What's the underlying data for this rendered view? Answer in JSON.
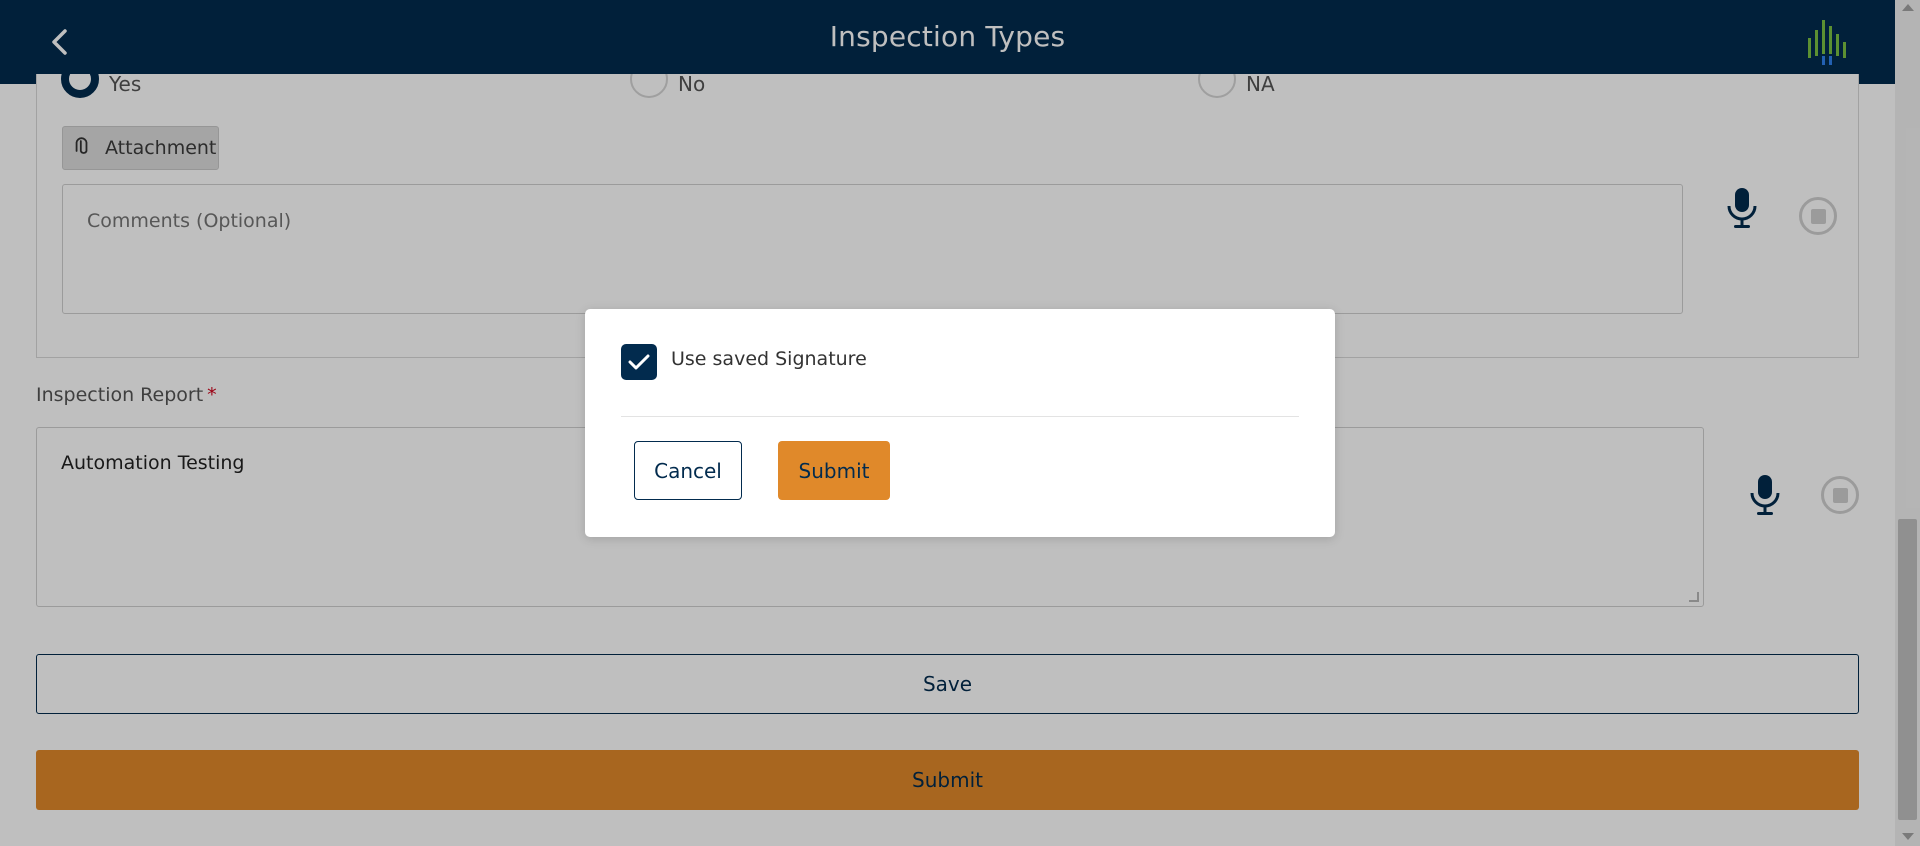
{
  "header": {
    "title": "Inspection Types",
    "back_icon": "chevron-left-icon",
    "logo_icon": "bar-logo-icon"
  },
  "question": {
    "options": [
      {
        "label": "Yes",
        "selected": true
      },
      {
        "label": "No",
        "selected": false
      },
      {
        "label": "NA",
        "selected": false
      }
    ],
    "attachment_label": "Attachment",
    "comments_placeholder": "Comments (Optional)"
  },
  "report": {
    "label": "Inspection Report",
    "required_mark": "*",
    "value": "Automation Testing"
  },
  "actions": {
    "save_label": "Save",
    "submit_label": "Submit"
  },
  "modal": {
    "checkbox_label": "Use saved Signature",
    "checked": true,
    "cancel_label": "Cancel",
    "submit_label": "Submit"
  },
  "colors": {
    "primary": "#022b4e",
    "accent": "#e0892a",
    "required": "#d0021b"
  }
}
